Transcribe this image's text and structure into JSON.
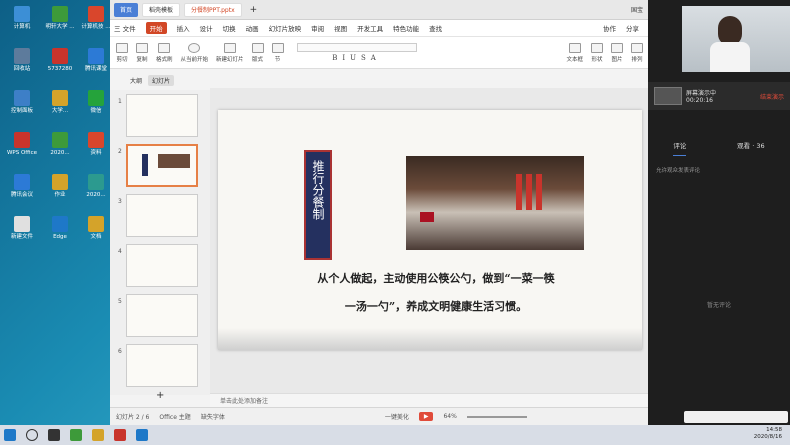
{
  "desktop": {
    "icons": [
      {
        "label": "计算机",
        "color": "#3c8fd6"
      },
      {
        "label": "明轩大学 ...",
        "color": "#3d9a3a"
      },
      {
        "label": "计算机技 ...",
        "color": "#d9462c"
      },
      {
        "label": "回收站",
        "color": "#5d7b9c"
      },
      {
        "label": "5737280",
        "color": "#c8342c"
      },
      {
        "label": "腾讯课堂",
        "color": "#2c7ad6"
      },
      {
        "label": "控制面板",
        "color": "#3d7fc7"
      },
      {
        "label": "大学...",
        "color": "#d4a32a"
      },
      {
        "label": "微信",
        "color": "#25a33b"
      },
      {
        "label": "WPS Office",
        "color": "#c8342c"
      },
      {
        "label": "2020...",
        "color": "#3d9a3a"
      },
      {
        "label": "资料",
        "color": "#d9462c"
      },
      {
        "label": "腾讯会议",
        "color": "#2c7ad6"
      },
      {
        "label": "作业",
        "color": "#d4a32a"
      },
      {
        "label": "2020...",
        "color": "#2c9a8f"
      },
      {
        "label": "新建文件",
        "color": "#e0e0e0"
      },
      {
        "label": "Edge",
        "color": "#1e78c8"
      },
      {
        "label": "文档",
        "color": "#d4a32a"
      }
    ]
  },
  "app": {
    "tabs": {
      "home": "首页",
      "doc": "稻壳模板",
      "ppt": "分餐制PPT.pptx"
    },
    "account": "国宝",
    "menu": [
      "三 文件",
      "开始",
      "插入",
      "设计",
      "切换",
      "动画",
      "幻灯片放映",
      "审阅",
      "视图",
      "开发工具",
      "特色功能",
      "查找"
    ],
    "menu_extra": [
      "协作",
      "分享"
    ],
    "ribbon": [
      "剪切",
      "复制",
      "格式刷",
      "从当前开始",
      "新建幻灯片",
      "版式",
      "节",
      "文本框",
      "形状",
      "图片",
      "排列"
    ],
    "panetabs": [
      "大纲",
      "幻灯片"
    ],
    "slide": {
      "banner": "推行分餐制",
      "line1": "从个人做起，主动使用公筷公勺，做到“一菜一筷",
      "line2": "一汤一勺”，养成文明健康生活习惯。"
    },
    "notes": "单击此处添加备注",
    "status": {
      "slide": "幻灯片 2 / 6",
      "theme": "Office 主题",
      "font": "缺失字体",
      "beautify": "一键美化",
      "zoom": "64%"
    }
  },
  "live": {
    "status": "屏幕演示中",
    "timer": "00:20:16",
    "end": "结束演示",
    "tabs": {
      "comment": "评论",
      "viewers": "观看 · 36"
    },
    "allow": "允许观众发表评论",
    "empty": "暂无评论"
  },
  "taskbar": {
    "time": "14:58",
    "date": "2020/8/16"
  }
}
